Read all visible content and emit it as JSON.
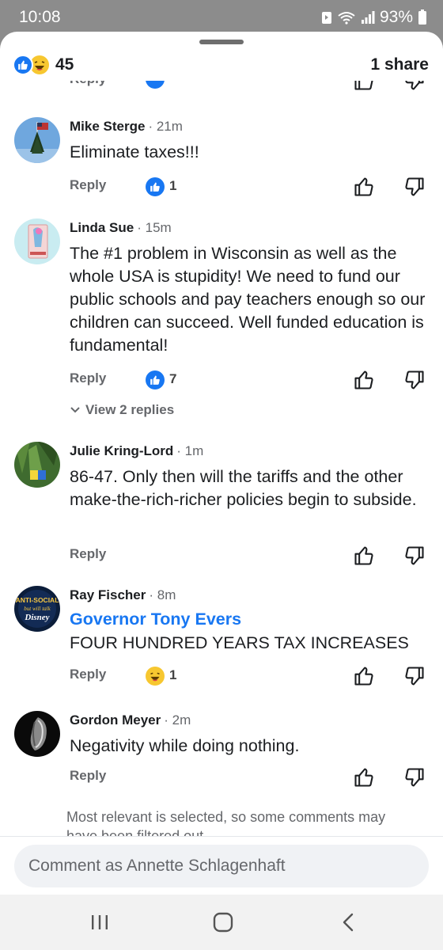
{
  "status_bar": {
    "time": "10:08",
    "battery": "93%"
  },
  "header": {
    "reaction_count": "45",
    "share_count": "1 share",
    "clipped_reply": "Reply"
  },
  "comments": [
    {
      "author": "Mike Sterge",
      "time": "· 21m",
      "text": "Eliminate taxes!!!",
      "reply_label": "Reply",
      "reaction": "like",
      "reaction_count": "1"
    },
    {
      "author": "Linda Sue",
      "time": "· 15m",
      "text": "The #1 problem in Wisconsin as well as the whole USA is stupidity!  We need to fund our public schools and pay teachers enough so our children can succeed.  Well funded education is fundamental!",
      "reply_label": "Reply",
      "reaction": "like",
      "reaction_count": "7",
      "view_replies": "View 2 replies"
    },
    {
      "author": "Julie Kring-Lord",
      "time": "· 1m",
      "text": "86-47. Only then will the tariffs and the other make-the-rich-richer policies begin to subside.",
      "reply_label": "Reply"
    },
    {
      "author": "Ray Fischer",
      "time": "· 8m",
      "tag": "Governor Tony Evers",
      "text": "FOUR HUNDRED YEARS TAX INCREASES",
      "reply_label": "Reply",
      "reaction": "haha",
      "reaction_count": "1",
      "avatar_text": [
        "ANTI-SOCIAL",
        "but will talk",
        "Disney"
      ]
    },
    {
      "author": "Gordon Meyer",
      "time": "· 2m",
      "text": "Negativity while doing nothing.",
      "reply_label": "Reply"
    }
  ],
  "filter_note": "Most relevant is selected, so some comments may have been filtered out.",
  "composer": {
    "placeholder": "Comment as Annette Schlagenhaft"
  },
  "icons": {
    "thumb_up": "thumbs-up-outline-icon",
    "thumb_down": "thumbs-down-outline-icon",
    "nav_recents": "recents-icon",
    "nav_home": "home-icon",
    "nav_back": "back-icon"
  },
  "colors": {
    "like_blue": "#1877f2",
    "haha_yellow": "#f7c730",
    "tag_blue": "#1877f2",
    "muted": "#65676b"
  }
}
